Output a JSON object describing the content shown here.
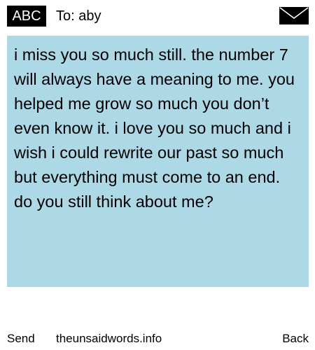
{
  "header": {
    "badge": "ABC",
    "recipient": "To: aby",
    "icon": "envelope-icon"
  },
  "message": {
    "text": "i miss you so much still. the number 7 will always have a meaning to me. you helped me grow so much you don’t even know it. i love you so much and i wish i could rewrite our past so much but everything must come to an end. do you still think about me?"
  },
  "footer": {
    "send": "Send",
    "site": "theunsaidwords.info",
    "back": "Back"
  },
  "colors": {
    "message_background": "#add8e6",
    "badge_background": "#000000",
    "page_background": "#ffffff"
  }
}
